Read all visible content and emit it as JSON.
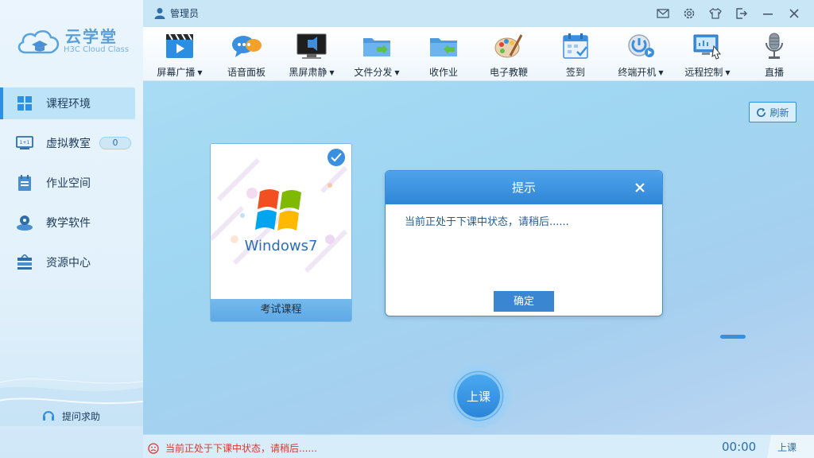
{
  "app": {
    "brand": "云学堂",
    "brand_sub": "H3C Cloud Class"
  },
  "user": {
    "name": "管理员"
  },
  "toolbar": [
    {
      "label": "屏幕广播",
      "icon": "screen-broadcast-icon",
      "dropdown": true
    },
    {
      "label": "语音面板",
      "icon": "voice-panel-icon",
      "dropdown": false
    },
    {
      "label": "黑屏肃静",
      "icon": "black-screen-icon",
      "dropdown": true
    },
    {
      "label": "文件分发",
      "icon": "file-distribute-icon",
      "dropdown": true
    },
    {
      "label": "收作业",
      "icon": "collect-homework-icon",
      "dropdown": false
    },
    {
      "label": "电子教鞭",
      "icon": "electronic-pointer-icon",
      "dropdown": false
    },
    {
      "label": "签到",
      "icon": "sign-in-icon",
      "dropdown": false
    },
    {
      "label": "终端开机",
      "icon": "terminal-power-icon",
      "dropdown": true
    },
    {
      "label": "远程控制",
      "icon": "remote-control-icon",
      "dropdown": true
    },
    {
      "label": "直播",
      "icon": "live-microphone-icon",
      "dropdown": false
    }
  ],
  "nav": [
    {
      "label": "课程环境",
      "icon": "windows-grid-icon",
      "active": true
    },
    {
      "label": "虚拟教室",
      "icon": "virtual-classroom-icon",
      "badge": "0"
    },
    {
      "label": "作业空间",
      "icon": "homework-icon"
    },
    {
      "label": "教学软件",
      "icon": "software-icon"
    },
    {
      "label": "资源中心",
      "icon": "resource-icon"
    }
  ],
  "help": {
    "label": "提问求助"
  },
  "main": {
    "refresh_label": "刷新",
    "course_card": {
      "title": "考试课程",
      "os_text": "Windows7",
      "selected": true
    },
    "start_label": "上课"
  },
  "dialog": {
    "title": "提示",
    "message": "当前正处于下课中状态，请稍后......",
    "ok_label": "确定"
  },
  "status": {
    "message": "当前正处于下课中状态，请稍后......",
    "timer": "00:00",
    "class_state": "上课"
  },
  "colors": {
    "accent": "#2f8fe0",
    "status_error": "#e0352b"
  }
}
